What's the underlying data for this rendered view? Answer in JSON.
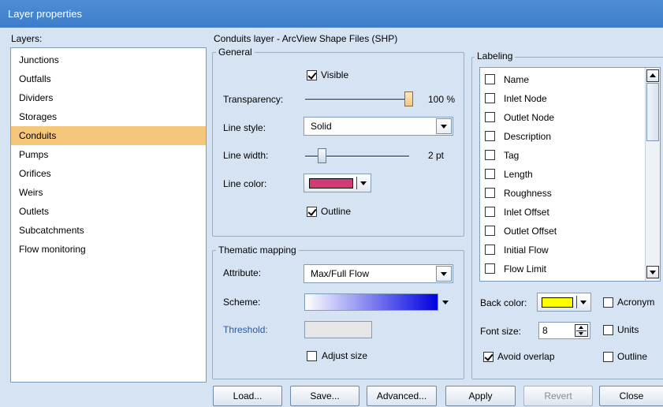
{
  "window": {
    "title": "Layer properties"
  },
  "layers": {
    "heading": "Layers:",
    "items": [
      "Junctions",
      "Outfalls",
      "Dividers",
      "Storages",
      "Conduits",
      "Pumps",
      "Orifices",
      "Weirs",
      "Outlets",
      "Subcatchments",
      "Flow monitoring"
    ],
    "selected": "Conduits"
  },
  "layer_title": "Conduits layer - ArcView Shape Files (SHP)",
  "general": {
    "title": "General",
    "visible_label": "Visible",
    "visible_checked": true,
    "transparency_label": "Transparency:",
    "transparency_value": "100 %",
    "transparency_level": 1.0,
    "line_style_label": "Line style:",
    "line_style_value": "Solid",
    "line_width_label": "Line width:",
    "line_width_value": "2 pt",
    "line_color_label": "Line color:",
    "line_color": "#d23a78",
    "outline_label": "Outline",
    "outline_checked": true
  },
  "thematic": {
    "title": "Thematic mapping",
    "attribute_label": "Attribute:",
    "attribute_value": "Max/Full Flow",
    "scheme_label": "Scheme:",
    "scheme_colors": [
      "#ffffff",
      "#0000e0"
    ],
    "threshold_label": "Threshold:",
    "adjust_size_label": "Adjust size",
    "adjust_size_checked": false
  },
  "labeling": {
    "title": "Labeling",
    "items": [
      "Name",
      "Inlet Node",
      "Outlet Node",
      "Description",
      "Tag",
      "Length",
      "Roughness",
      "Inlet Offset",
      "Outlet Offset",
      "Initial Flow",
      "Flow Limit"
    ],
    "back_color_label": "Back color:",
    "back_color": "#ffff00",
    "acronym_label": "Acronym",
    "font_size_label": "Font size:",
    "font_size_value": "8",
    "units_label": "Units",
    "avoid_overlap_label": "Avoid overlap",
    "avoid_overlap_checked": true,
    "outline_label": "Outline"
  },
  "buttons": {
    "load": "Load...",
    "save": "Save...",
    "advanced": "Advanced...",
    "apply": "Apply",
    "revert": "Revert",
    "close": "Close"
  }
}
